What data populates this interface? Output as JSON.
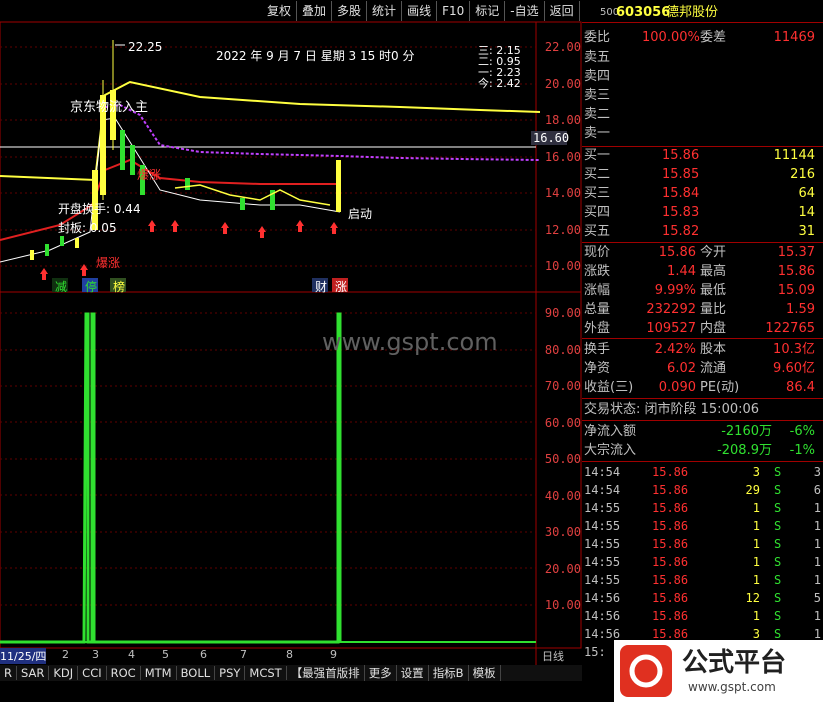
{
  "toolbar": [
    "复权",
    "叠加",
    "多股",
    "统计",
    "画线",
    "F10",
    "标记",
    "-自选",
    "返回"
  ],
  "header": {
    "date_line": "2022 年 9 月 7 日 星期 3  15 时0 分",
    "peak": "22.25",
    "legend": [
      "三: 2.15",
      "二: 0.95",
      "一: 2.23",
      "今: 2.42"
    ],
    "title_text": "京东物流入主",
    "open_turnover": "开盘换手: 0.44",
    "seal": "封板: 0.05",
    "launch": "启动",
    "surge": "爆涨"
  },
  "price_axis": [
    "22.00",
    "20.00",
    "18.00",
    "16.00",
    "14.00",
    "12.00",
    "10.00"
  ],
  "price_highlight": "16.60",
  "indicator_axis": [
    "90.00",
    "80.00",
    "70.00",
    "60.00",
    "50.00",
    "40.00",
    "30.00",
    "20.00",
    "10.00"
  ],
  "markers": [
    "减",
    "停",
    "榜",
    "财",
    "涨"
  ],
  "watermark": "www.gspt.com",
  "xaxis": [
    "11/25/四",
    "2",
    "3",
    "4",
    "5",
    "6",
    "7",
    "8",
    "9",
    "日线"
  ],
  "bottom_tabs": [
    "R",
    "SAR",
    "KDJ",
    "CCI",
    "ROC",
    "MTM",
    "BOLL",
    "PSY",
    "MCST",
    "【最强首版排",
    "更多",
    "设置",
    "指标B",
    "模板"
  ],
  "stock": {
    "num": "500",
    "code": "603056",
    "name": "德邦股份"
  },
  "order": {
    "ratio_label": "委比",
    "ratio": "100.00%",
    "diff_label": "委差",
    "diff": "11469"
  },
  "sells": [
    {
      "label": "卖五"
    },
    {
      "label": "卖四"
    },
    {
      "label": "卖三"
    },
    {
      "label": "卖二"
    },
    {
      "label": "卖一"
    }
  ],
  "buys": [
    {
      "label": "买一",
      "price": "15.86",
      "vol": "11144"
    },
    {
      "label": "买二",
      "price": "15.85",
      "vol": "216"
    },
    {
      "label": "买三",
      "price": "15.84",
      "vol": "64"
    },
    {
      "label": "买四",
      "price": "15.83",
      "vol": "14"
    },
    {
      "label": "买五",
      "price": "15.82",
      "vol": "31"
    }
  ],
  "quote": [
    {
      "l1": "现价",
      "v1": "15.86",
      "l2": "今开",
      "v2": "15.37"
    },
    {
      "l1": "涨跌",
      "v1": "1.44",
      "l2": "最高",
      "v2": "15.86"
    },
    {
      "l1": "涨幅",
      "v1": "9.99%",
      "l2": "最低",
      "v2": "15.09"
    },
    {
      "l1": "总量",
      "v1": "232292",
      "l2": "量比",
      "v2": "1.59"
    },
    {
      "l1": "外盘",
      "v1": "109527",
      "l2": "内盘",
      "v2": "122765"
    }
  ],
  "fund": [
    {
      "l1": "换手",
      "v1": "2.42%",
      "l2": "股本",
      "v2": "10.3亿"
    },
    {
      "l1": "净资",
      "v1": "6.02",
      "l2": "流通",
      "v2": "9.60亿"
    },
    {
      "l1": "收益(三)",
      "v1": "0.090",
      "l2": "PE(动)",
      "v2": "86.4"
    }
  ],
  "status": "交易状态: 闭市阶段 15:00:06",
  "flows": [
    {
      "label": "净流入额",
      "v": "-2160万",
      "p": "-6%"
    },
    {
      "label": "大宗流入",
      "v": "-208.9万",
      "p": "-1%"
    }
  ],
  "ticks": [
    {
      "t": "14:54",
      "p": "15.86",
      "v": "3",
      "s": "S",
      "n": "3"
    },
    {
      "t": "14:54",
      "p": "15.86",
      "v": "29",
      "s": "S",
      "n": "6"
    },
    {
      "t": "14:55",
      "p": "15.86",
      "v": "1",
      "s": "S",
      "n": "1"
    },
    {
      "t": "14:55",
      "p": "15.86",
      "v": "1",
      "s": "S",
      "n": "1"
    },
    {
      "t": "14:55",
      "p": "15.86",
      "v": "1",
      "s": "S",
      "n": "1"
    },
    {
      "t": "14:55",
      "p": "15.86",
      "v": "1",
      "s": "S",
      "n": "1"
    },
    {
      "t": "14:55",
      "p": "15.86",
      "v": "1",
      "s": "S",
      "n": "1"
    },
    {
      "t": "14:56",
      "p": "15.86",
      "v": "12",
      "s": "S",
      "n": "5"
    },
    {
      "t": "14:56",
      "p": "15.86",
      "v": "1",
      "s": "S",
      "n": "1"
    },
    {
      "t": "14:56",
      "p": "15.86",
      "v": "3",
      "s": "S",
      "n": "1"
    },
    {
      "t": "15:",
      "p": "",
      "v": "",
      "s": "",
      "n": ""
    }
  ],
  "brand": {
    "text": "公式平台",
    "url": "www.gspt.com"
  },
  "colors": {
    "red": "#ff3030",
    "green": "#30e030",
    "yellow": "#ffff40",
    "purple": "#c040ff",
    "white": "#ffffff"
  }
}
